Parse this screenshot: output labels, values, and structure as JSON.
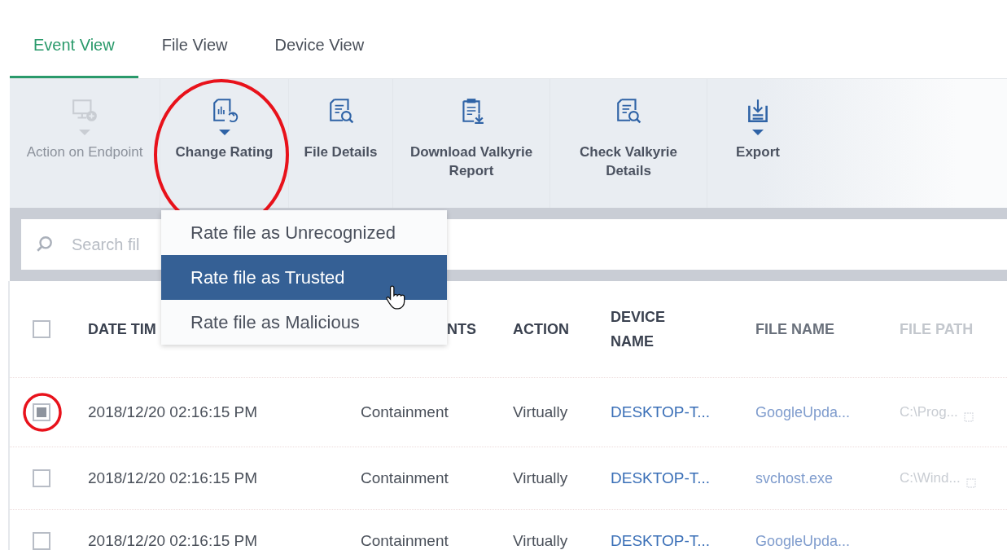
{
  "tabs": [
    {
      "label": "Event View",
      "selected": true
    },
    {
      "label": "File View",
      "selected": false
    },
    {
      "label": "Device View",
      "selected": false
    }
  ],
  "toolbar": [
    {
      "label": "Action on Endpoint",
      "kind": "monitor",
      "has_menu": true,
      "disabled": true,
      "annotated": false
    },
    {
      "label": "Change Rating",
      "kind": "rating",
      "has_menu": true,
      "disabled": false,
      "annotated": true
    },
    {
      "label": "File Details",
      "kind": "details",
      "has_menu": false,
      "disabled": false,
      "annotated": false
    },
    {
      "label": "Download Valkyrie Report",
      "kind": "download",
      "has_menu": false,
      "disabled": false,
      "annotated": false
    },
    {
      "label": "Check Valkyrie Details",
      "kind": "details",
      "has_menu": false,
      "disabled": false,
      "annotated": false
    },
    {
      "label": "Export",
      "kind": "export",
      "has_menu": true,
      "disabled": false,
      "annotated": false
    }
  ],
  "search": {
    "placeholder": "Search fil"
  },
  "dropdown": [
    {
      "label": "Rate file as Unrecognized",
      "selected": false
    },
    {
      "label": "Rate file as Trusted",
      "selected": true
    },
    {
      "label": "Rate file as Malicious",
      "selected": false
    }
  ],
  "table": {
    "header_checked": false,
    "columns": [
      "DATE TIM",
      "NTS",
      "ACTION",
      "DEVICE NAME",
      "FILE NAME",
      "FILE PATH"
    ],
    "rows": [
      {
        "checked": true,
        "annotated": true,
        "cells": [
          "2018/12/20 02:16:15 PM",
          "Containment",
          "Virtually",
          "DESKTOP-T...",
          "GoogleUpda...",
          "C:\\Prog..."
        ]
      },
      {
        "checked": false,
        "cells": [
          "2018/12/20 02:16:15 PM",
          "Containment",
          "Virtually",
          "DESKTOP-T...",
          "svchost.exe",
          "C:\\Wind..."
        ]
      },
      {
        "checked": false,
        "cells": [
          "2018/12/20 02:16:15 PM",
          "Containment",
          "Virtually",
          "DESKTOP-T...",
          "GoogleUpda..."
        ]
      }
    ]
  }
}
